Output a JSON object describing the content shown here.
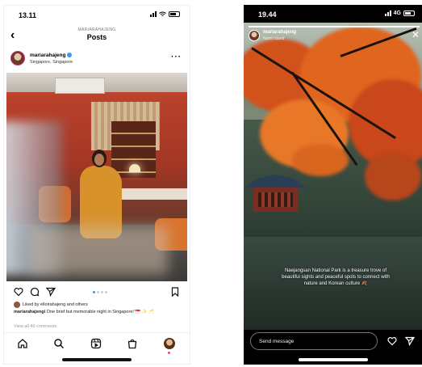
{
  "left_phone": {
    "status_time": "13.11",
    "header_username": "MARIARAHAJENG",
    "header_title": "Posts",
    "post": {
      "username": "mariarahajeng",
      "location": "Singapore, Singapore",
      "liked_by": "Liked by elloirahajeng and others",
      "caption_user": "mariarahajengi",
      "caption_text": "One brief but memorable night in Singapore! 🇸🇬 ✨ 🥂",
      "view_comments": "View all 40 comments",
      "carousel_dots": 4,
      "carousel_active": 1
    },
    "tabs": [
      "home-icon",
      "search-icon",
      "reels-icon",
      "shop-icon",
      "profile-icon"
    ]
  },
  "right_phone": {
    "status_time": "19.44",
    "status_network": "4G",
    "story_username": "mariarahajeng",
    "story_location": "Nami Island",
    "story_text": "Naejangsan National Park is a treasure trove of beautiful sights and peaceful spots to connect with nature and Korean culture 🍂",
    "send_message_placeholder": "Send message"
  },
  "colors": {
    "accent_blue": "#3897f0",
    "notification_red": "#ed4956",
    "story_bg": "#000000"
  }
}
